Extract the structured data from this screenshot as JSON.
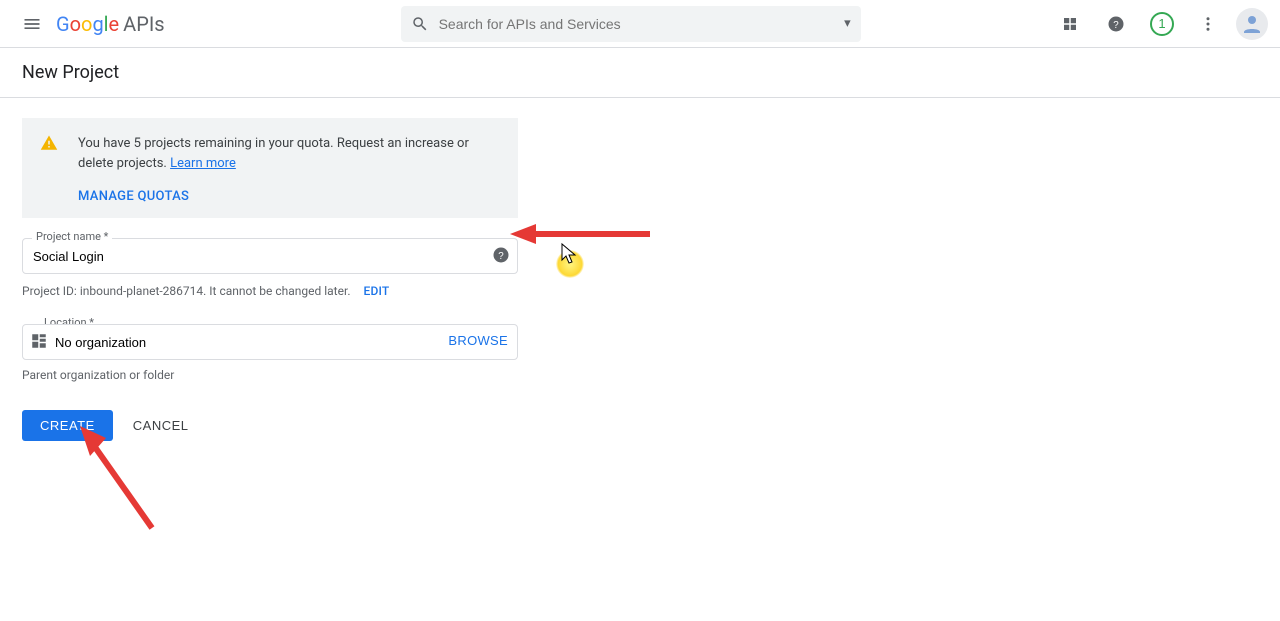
{
  "header": {
    "logo_text": "Google",
    "apis_label": "APIs",
    "search_placeholder": "Search for APIs and Services",
    "notif_count": "1"
  },
  "page": {
    "title": "New Project"
  },
  "quota": {
    "message": "You have 5 projects remaining in your quota. Request an increase or delete projects. ",
    "learn_more": "Learn more",
    "manage": "MANAGE QUOTAS"
  },
  "project_name": {
    "label": "Project name *",
    "value": "Social Login"
  },
  "project_id": {
    "prefix": "Project ID: ",
    "value": "inbound-planet-286714",
    "suffix": ". It cannot be changed later.",
    "edit": "EDIT"
  },
  "location": {
    "label": "Location *",
    "value": "No organization",
    "browse": "BROWSE",
    "hint": "Parent organization or folder"
  },
  "buttons": {
    "create": "CREATE",
    "cancel": "CANCEL"
  }
}
